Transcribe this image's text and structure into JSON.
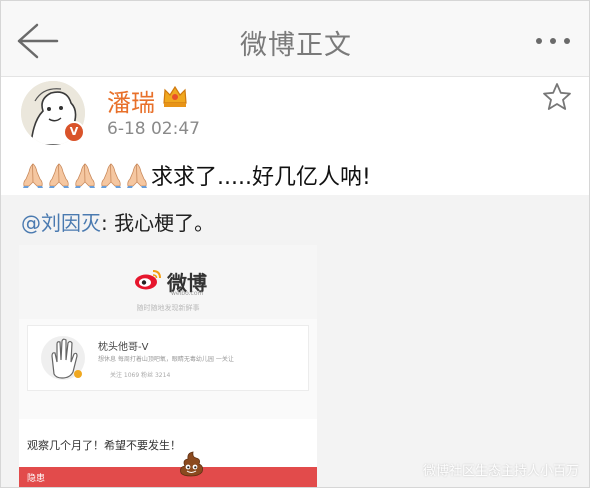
{
  "navbar": {
    "title": "微博正文",
    "back_icon": "back-arrow-icon",
    "more_icon": "more-dots-icon"
  },
  "post": {
    "username": "潘瑞",
    "verified_badge": "V",
    "timestamp": "6-18 02:47",
    "text": "求求了.....好几亿人呐!",
    "pray_emoji_count": 5,
    "username_color": "#e8702a"
  },
  "repost": {
    "mention": "@刘因灭",
    "comment": ": 我心梗了。",
    "mention_color": "#4a7ab0"
  },
  "embed": {
    "logo_text": "微博",
    "logo_sub": "weibo.com",
    "slogan": "随时随地发现新鲜事",
    "profile_name": "枕头他哥-V",
    "profile_desc": "想休息 每周打着山顶吧氧，眼睛无毒幼儿园 一关让",
    "profile_stats": "关注 1069    粉丝 3214",
    "message": "观察几个月了！希望不要发生！",
    "redbar_label": "隐患"
  },
  "watermark": "微博社区生态主持人小百万"
}
